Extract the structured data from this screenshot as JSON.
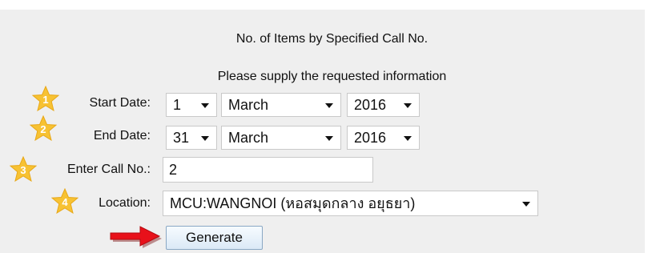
{
  "report": {
    "title": "No. of Items by Specified Call No.",
    "instruction": "Please supply the requested information"
  },
  "form": {
    "start_date": {
      "label": "Start Date:",
      "day": "1",
      "month": "March",
      "year": "2016"
    },
    "end_date": {
      "label": "End Date:",
      "day": "31",
      "month": "March",
      "year": "2016"
    },
    "call_no": {
      "label": "Enter Call No.:",
      "value": "2"
    },
    "location": {
      "label": "Location:",
      "value": "MCU:WANGNOI (หอสมุดกลาง อยุธยา)"
    },
    "generate_label": "Generate"
  },
  "step_markers": [
    "1",
    "2",
    "3",
    "4"
  ],
  "colors": {
    "star": "#f7c233",
    "arrow": "#e8111a",
    "panel": "#efefef"
  },
  "icons": {
    "step": "star-icon",
    "pointer": "arrow-right-icon"
  }
}
